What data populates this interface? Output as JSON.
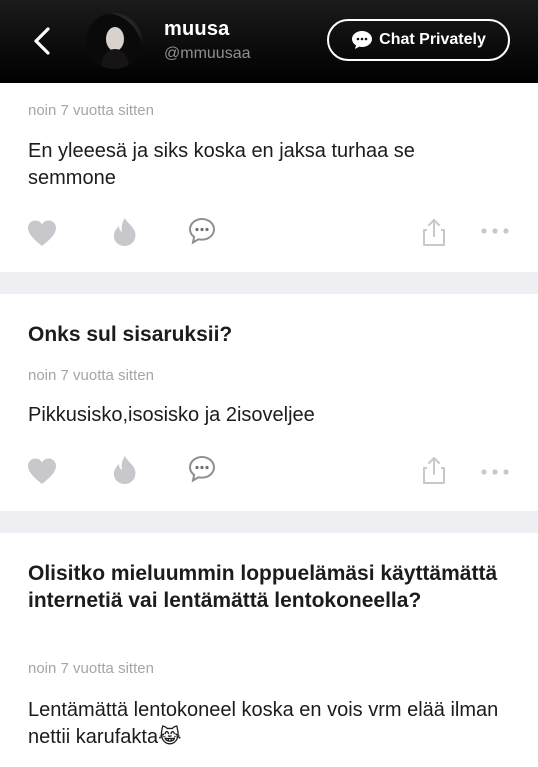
{
  "header": {
    "username": "muusa",
    "handle": "@mmuusaa",
    "chat_button_label": "Chat Privately"
  },
  "posts": [
    {
      "question": "",
      "timestamp": "noin 7 vuotta sitten",
      "answer": "En yleeesä ja siks koska en jaksa turhaa se semmone"
    },
    {
      "question": "Onks sul sisaruksii?",
      "timestamp": "noin 7 vuotta sitten",
      "answer": "Pikkusisko,isosisko ja 2isoveljee"
    },
    {
      "question": "Olisitko mieluummin loppuelämäsi käyttämättä internetiä vai lentämättä lentokoneella?",
      "timestamp": "noin 7 vuotta sitten",
      "answer": "Lentämättä lentokoneel koska en vois vrm elää ilman nettii karufakta😹"
    }
  ],
  "colors": {
    "header_bg": "#000000",
    "icon_gray": "#c7c7cc",
    "divider": "#eeeef3",
    "meta_text": "#a5a5aa"
  }
}
